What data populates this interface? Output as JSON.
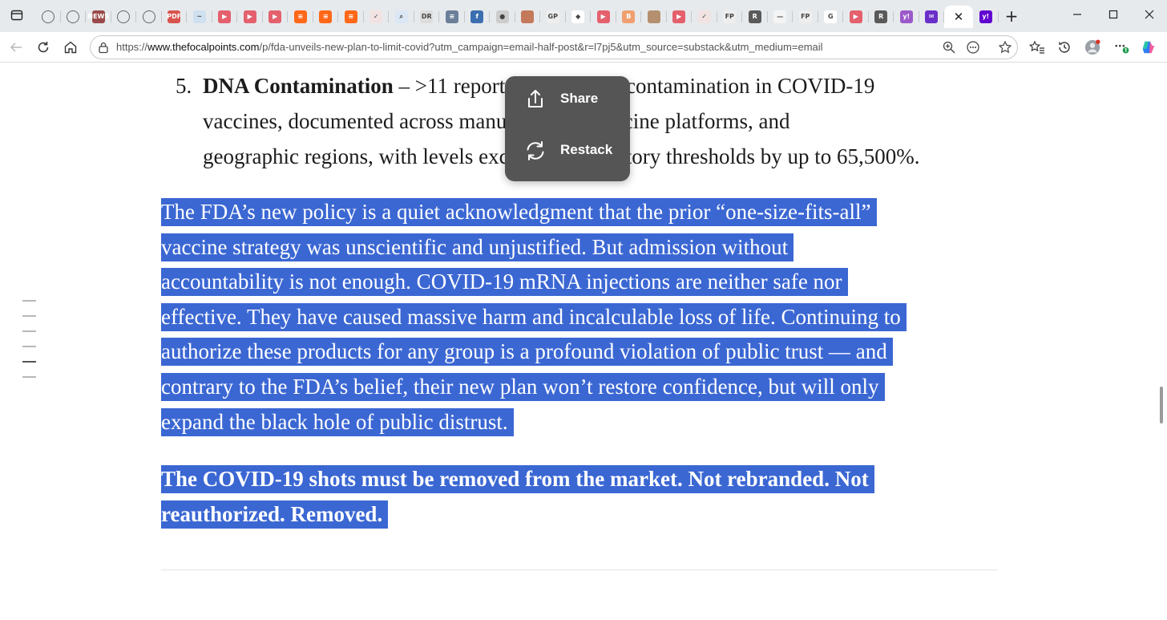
{
  "browser": {
    "tabs": [
      {
        "icon": "globe-icon",
        "text": "",
        "bg": "transparent",
        "style": "globe"
      },
      {
        "icon": "globe-icon",
        "text": "",
        "bg": "transparent",
        "style": "globe"
      },
      {
        "icon": "news-icon",
        "text": "NEWS",
        "bg": "#9a4a4a",
        "style": "plain"
      },
      {
        "icon": "globe-icon",
        "text": "",
        "bg": "transparent",
        "style": "globe"
      },
      {
        "icon": "globe-icon",
        "text": "",
        "bg": "transparent",
        "style": "globe"
      },
      {
        "icon": "pdf-icon",
        "text": "PDF",
        "bg": "#d9534f",
        "style": "plain"
      },
      {
        "icon": "heartbeat-icon",
        "text": "~",
        "bg": "#cfe0f0",
        "style": "light"
      },
      {
        "icon": "youtube-icon",
        "text": "▶",
        "bg": "#e4606d",
        "style": "plain"
      },
      {
        "icon": "youtube-icon",
        "text": "▶",
        "bg": "#e4606d",
        "style": "plain"
      },
      {
        "icon": "youtube-icon",
        "text": "▶",
        "bg": "#e4606d",
        "style": "plain"
      },
      {
        "icon": "substack-icon",
        "text": "≡",
        "bg": "#ff6719",
        "style": "plain"
      },
      {
        "icon": "substack-icon",
        "text": "≡",
        "bg": "#ff6719",
        "style": "plain"
      },
      {
        "icon": "substack-icon",
        "text": "≡",
        "bg": "#ff6719",
        "style": "plain"
      },
      {
        "icon": "bird-icon",
        "text": "✓",
        "bg": "#f2e3e3",
        "style": "light"
      },
      {
        "icon": "search-icon",
        "text": "⌕",
        "bg": "#dbe7f5",
        "style": "light"
      },
      {
        "icon": "dr-icon",
        "text": "DR",
        "bg": "#dddddd",
        "style": "light"
      },
      {
        "icon": "newspaper-icon",
        "text": "≡",
        "bg": "#6b7f99",
        "style": "plain"
      },
      {
        "icon": "blue-square-icon",
        "text": "f",
        "bg": "#3c6fb0",
        "style": "plain"
      },
      {
        "icon": "seal-icon",
        "text": "●",
        "bg": "#cccccc",
        "style": "light"
      },
      {
        "icon": "image-icon",
        "text": "",
        "bg": "#c47a5a",
        "style": "plain"
      },
      {
        "icon": "gp-icon",
        "text": "GP",
        "bg": "#eeeeee",
        "style": "light"
      },
      {
        "icon": "diamond-icon",
        "text": "◆",
        "bg": "#ffffff",
        "style": "light"
      },
      {
        "icon": "youtube-icon",
        "text": "▶",
        "bg": "#e4606d",
        "style": "plain"
      },
      {
        "icon": "orange-box-icon",
        "text": "B",
        "bg": "#f0a070",
        "style": "plain"
      },
      {
        "icon": "photo-icon",
        "text": "",
        "bg": "#b49070",
        "style": "plain"
      },
      {
        "icon": "youtube-icon",
        "text": "▶",
        "bg": "#e4606d",
        "style": "plain"
      },
      {
        "icon": "bird-icon",
        "text": "✓",
        "bg": "#f2e3e3",
        "style": "light"
      },
      {
        "icon": "fp-icon",
        "text": "FP",
        "bg": "#eeeeee",
        "style": "light"
      },
      {
        "icon": "r-icon",
        "text": "R",
        "bg": "#5a5a5a",
        "style": "plain"
      },
      {
        "icon": "blank-page-icon",
        "text": "—",
        "bg": "#f4f4f4",
        "style": "light"
      },
      {
        "icon": "fp-icon",
        "text": "FP",
        "bg": "#eeeeee",
        "style": "light"
      },
      {
        "icon": "google-icon",
        "text": "G",
        "bg": "#ffffff",
        "style": "light"
      },
      {
        "icon": "youtube-icon",
        "text": "▶",
        "bg": "#e4606d",
        "style": "plain"
      },
      {
        "icon": "r-icon",
        "text": "R",
        "bg": "#5a5a5a",
        "style": "plain"
      },
      {
        "icon": "yahoo-icon",
        "text": "y!",
        "bg": "#9b59c9",
        "style": "plain"
      },
      {
        "icon": "mail-icon",
        "text": "✉",
        "bg": "#6b2fc9",
        "style": "plain"
      }
    ],
    "active_tab": {
      "icon": "close-icon",
      "close_glyph": "✕"
    },
    "after_active": {
      "icon": "yahoo-icon",
      "text": "y!",
      "bg": "#6001d2"
    },
    "new_tab_glyph": "+",
    "url_prefix": "https://",
    "url_host": "www.thefocalpoints.com",
    "url_path": "/p/fda-unveils-new-plan-to-limit-covid?utm_campaign=email-half-post&r=l7pj5&utm_source=substack&utm_medium=email"
  },
  "article": {
    "list_number": "5.",
    "list_bold": "DNA Contamination",
    "list_line1_rest": " – >11 reports found DNA contamination in COVID-19",
    "list_line2": "vaccines, documented across manufacturers, vaccine platforms, and",
    "list_line3": "geographic regions, with levels exceeding regulatory thresholds by up to 65,500%.",
    "para1_lines": [
      "The FDA’s new policy is a quiet acknowledgment that the prior “one-size-fits-all”",
      "vaccine strategy was unscientific and unjustified. But admission without",
      "accountability is not enough. COVID-19 mRNA injections are neither safe nor",
      "effective. They have caused massive harm and incalculable loss of life. Continuing to",
      "authorize these products for any group is a profound violation of public trust — and",
      "contrary to the FDA’s belief, their new plan won’t restore confidence, but will only",
      "expand the black hole of public distrust."
    ],
    "para2_lines": [
      "The COVID-19 shots must be removed from the market. Not rebranded. Not",
      "reauthorized. Removed."
    ]
  },
  "popup": {
    "share_label": "Share",
    "share_icon": "share-icon",
    "restack_label": "Restack",
    "restack_icon": "restack-icon"
  },
  "colors": {
    "selection": "#3b67d3",
    "popup_bg": "#555555"
  }
}
